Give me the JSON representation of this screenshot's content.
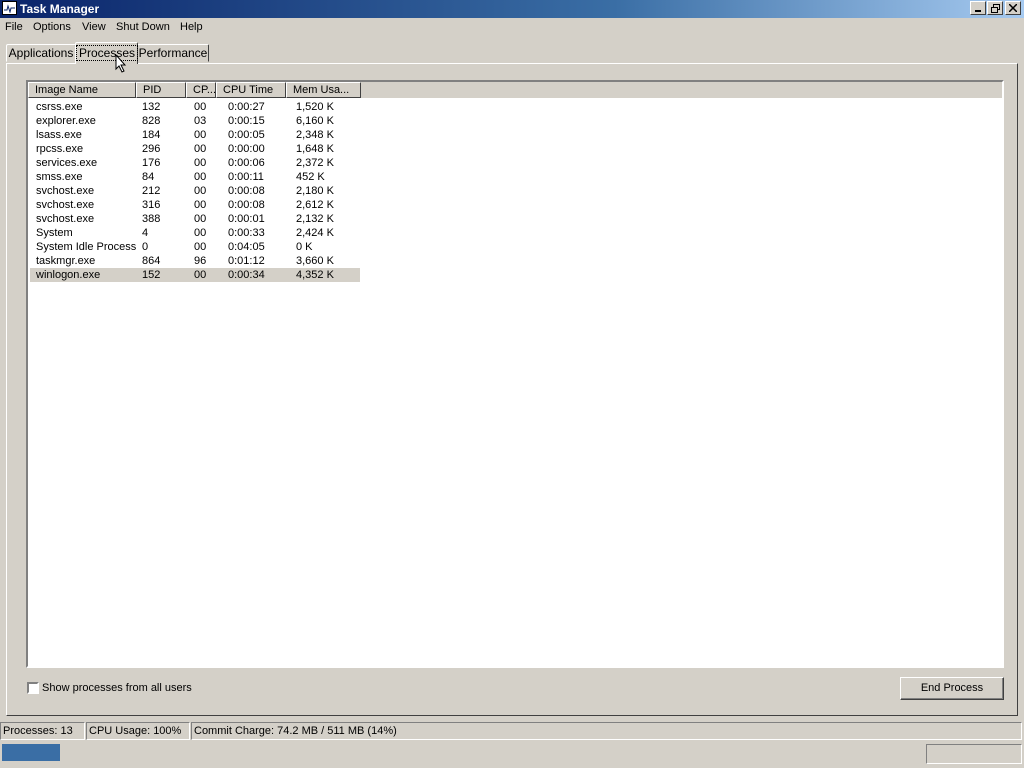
{
  "window": {
    "title": "Task Manager"
  },
  "menu": [
    {
      "label": "File"
    },
    {
      "label": "Options"
    },
    {
      "label": "View"
    },
    {
      "label": "Shut Down"
    },
    {
      "label": "Help"
    }
  ],
  "tabs": [
    {
      "label": "Applications"
    },
    {
      "label": "Processes",
      "active": true
    },
    {
      "label": "Performance"
    }
  ],
  "processes": {
    "columns": [
      "Image Name",
      "PID",
      "CP...",
      "CPU Time",
      "Mem Usa..."
    ],
    "rows": [
      [
        "csrss.exe",
        "132",
        "00",
        "0:00:27",
        "1,520 K"
      ],
      [
        "explorer.exe",
        "828",
        "03",
        "0:00:15",
        "6,160 K"
      ],
      [
        "lsass.exe",
        "184",
        "00",
        "0:00:05",
        "2,348 K"
      ],
      [
        "rpcss.exe",
        "296",
        "00",
        "0:00:00",
        "1,648 K"
      ],
      [
        "services.exe",
        "176",
        "00",
        "0:00:06",
        "2,372 K"
      ],
      [
        "smss.exe",
        "84",
        "00",
        "0:00:11",
        "452 K"
      ],
      [
        "svchost.exe",
        "212",
        "00",
        "0:00:08",
        "2,180 K"
      ],
      [
        "svchost.exe",
        "316",
        "00",
        "0:00:08",
        "2,612 K"
      ],
      [
        "svchost.exe",
        "388",
        "00",
        "0:00:01",
        "2,132 K"
      ],
      [
        "System",
        "4",
        "00",
        "0:00:33",
        "2,424 K"
      ],
      [
        "System Idle Process",
        "0",
        "00",
        "0:04:05",
        "0 K"
      ],
      [
        "taskmgr.exe",
        "864",
        "96",
        "0:01:12",
        "3,660 K"
      ],
      [
        "winlogon.exe",
        "152",
        "00",
        "0:00:34",
        "4,352 K"
      ]
    ],
    "selected_row": 12
  },
  "show_all_users": {
    "label": "Show processes from all users",
    "checked": false
  },
  "end_process_label": "End Process",
  "status": {
    "processes": "Processes: 13",
    "cpu": "CPU Usage: 100%",
    "commit": "Commit Charge: 74.2 MB / 511 MB (14%)"
  },
  "colors": {
    "titlebar_start": "#0a246a",
    "titlebar_end": "#a6caf0",
    "face": "#d4d0c8"
  }
}
